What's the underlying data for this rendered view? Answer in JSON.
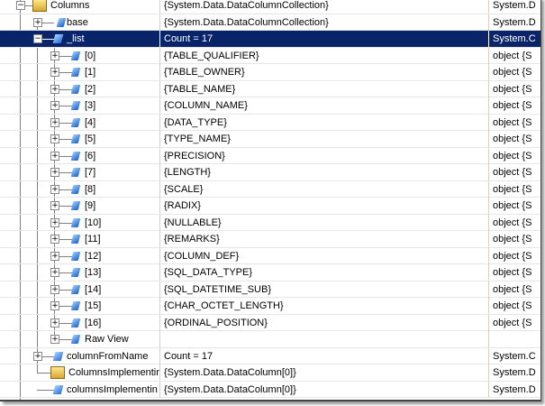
{
  "rows": [
    {
      "name": "Columns",
      "value": "{System.Data.DataColumnCollection}",
      "type": "System.D",
      "level": 0,
      "expander": "minus",
      "icon": "collection"
    },
    {
      "name": "base",
      "value": "{System.Data.DataColumnCollection}",
      "type": "System.D",
      "level": 1,
      "expander": "plus",
      "icon": "field"
    },
    {
      "name": "_list",
      "value": "Count = 17",
      "type": "System.C",
      "level": 1,
      "expander": "minus",
      "icon": "private-field",
      "selected": true
    },
    {
      "name": "[0]",
      "value": "{TABLE_QUALIFIER}",
      "type": "object {S",
      "level": 2,
      "expander": "plus",
      "icon": "field"
    },
    {
      "name": "[1]",
      "value": "{TABLE_OWNER}",
      "type": "object {S",
      "level": 2,
      "expander": "plus",
      "icon": "field"
    },
    {
      "name": "[2]",
      "value": "{TABLE_NAME}",
      "type": "object {S",
      "level": 2,
      "expander": "plus",
      "icon": "field"
    },
    {
      "name": "[3]",
      "value": "{COLUMN_NAME}",
      "type": "object {S",
      "level": 2,
      "expander": "plus",
      "icon": "field"
    },
    {
      "name": "[4]",
      "value": "{DATA_TYPE}",
      "type": "object {S",
      "level": 2,
      "expander": "plus",
      "icon": "field"
    },
    {
      "name": "[5]",
      "value": "{TYPE_NAME}",
      "type": "object {S",
      "level": 2,
      "expander": "plus",
      "icon": "field"
    },
    {
      "name": "[6]",
      "value": "{PRECISION}",
      "type": "object {S",
      "level": 2,
      "expander": "plus",
      "icon": "field"
    },
    {
      "name": "[7]",
      "value": "{LENGTH}",
      "type": "object {S",
      "level": 2,
      "expander": "plus",
      "icon": "field"
    },
    {
      "name": "[8]",
      "value": "{SCALE}",
      "type": "object {S",
      "level": 2,
      "expander": "plus",
      "icon": "field"
    },
    {
      "name": "[9]",
      "value": "{RADIX}",
      "type": "object {S",
      "level": 2,
      "expander": "plus",
      "icon": "field"
    },
    {
      "name": "[10]",
      "value": "{NULLABLE}",
      "type": "object {S",
      "level": 2,
      "expander": "plus",
      "icon": "field"
    },
    {
      "name": "[11]",
      "value": "{REMARKS}",
      "type": "object {S",
      "level": 2,
      "expander": "plus",
      "icon": "field"
    },
    {
      "name": "[12]",
      "value": "{COLUMN_DEF}",
      "type": "object {S",
      "level": 2,
      "expander": "plus",
      "icon": "field"
    },
    {
      "name": "[13]",
      "value": "{SQL_DATA_TYPE}",
      "type": "object {S",
      "level": 2,
      "expander": "plus",
      "icon": "field"
    },
    {
      "name": "[14]",
      "value": "{SQL_DATETIME_SUB}",
      "type": "object {S",
      "level": 2,
      "expander": "plus",
      "icon": "field"
    },
    {
      "name": "[15]",
      "value": "{CHAR_OCTET_LENGTH}",
      "type": "object {S",
      "level": 2,
      "expander": "plus",
      "icon": "field"
    },
    {
      "name": "[16]",
      "value": "{ORDINAL_POSITION}",
      "type": "object {S",
      "level": 2,
      "expander": "plus",
      "icon": "field"
    },
    {
      "name": "Raw View",
      "value": "",
      "type": "",
      "level": 2,
      "expander": "plus",
      "icon": "field"
    },
    {
      "name": "columnFromName",
      "value": "Count = 17",
      "type": "System.C",
      "level": 1,
      "expander": "plus",
      "icon": "private-field"
    },
    {
      "name": "ColumnsImplementin",
      "value": "{System.Data.DataColumn[0]}",
      "type": "System.D",
      "level": 1,
      "expander": "none",
      "icon": "collection"
    },
    {
      "name": "columnsImplementin",
      "value": "{System.Data.DataColumn[0]}",
      "type": "System.D",
      "level": 1,
      "expander": "none",
      "icon": "private-field"
    }
  ]
}
